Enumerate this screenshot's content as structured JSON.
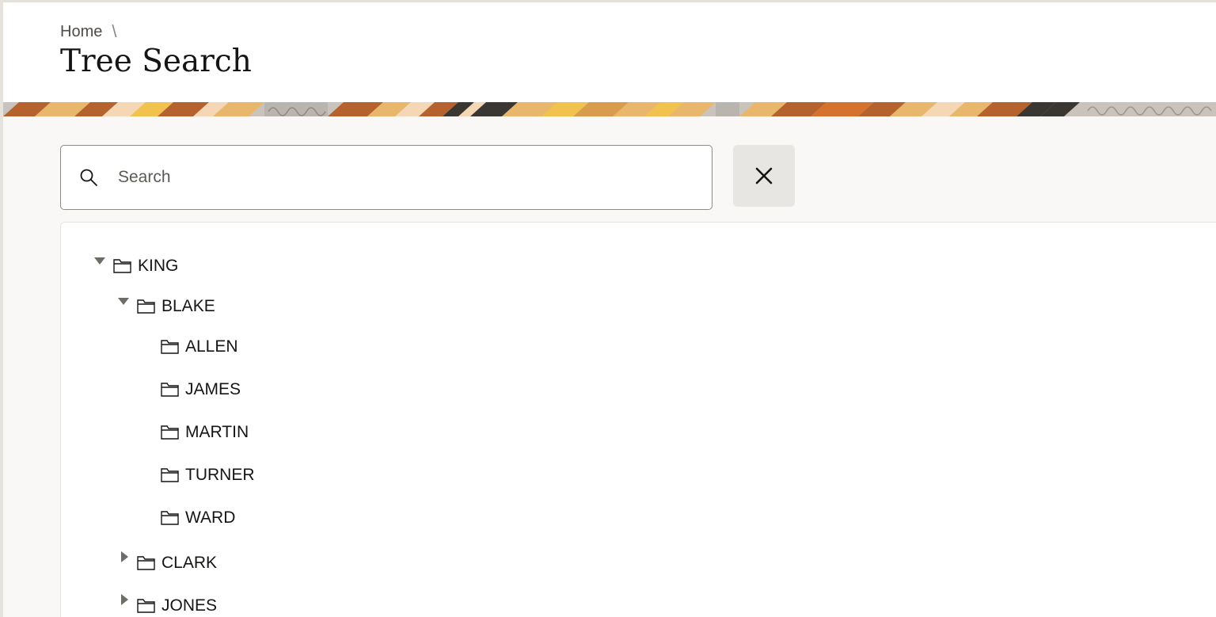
{
  "breadcrumb": {
    "home_label": "Home",
    "separator": "\\"
  },
  "page": {
    "title": "Tree Search"
  },
  "search": {
    "placeholder": "Search",
    "value": ""
  },
  "tree": {
    "nodes": [
      {
        "label": "KING",
        "expanded": true,
        "level": 0
      },
      {
        "label": "BLAKE",
        "expanded": true,
        "level": 1
      },
      {
        "label": "ALLEN",
        "level": 2
      },
      {
        "label": "JAMES",
        "level": 2
      },
      {
        "label": "MARTIN",
        "level": 2
      },
      {
        "label": "TURNER",
        "level": 2
      },
      {
        "label": "WARD",
        "level": 2
      },
      {
        "label": "CLARK",
        "expanded": false,
        "level": 1
      },
      {
        "label": "JONES",
        "expanded": false,
        "level": 1
      }
    ]
  },
  "colors": {
    "banner_brown": "#b5622e",
    "banner_tan": "#e9b76c",
    "banner_light": "#f6d7b5",
    "banner_dark": "#3a3733",
    "banner_grey": "#b9b4ad",
    "banner_yellow": "#f2c24f"
  },
  "icons": {
    "search": "search-icon",
    "clear": "close-icon",
    "folder": "folder-icon",
    "expanded": "triangle-down-icon",
    "collapsed": "triangle-right-icon"
  }
}
